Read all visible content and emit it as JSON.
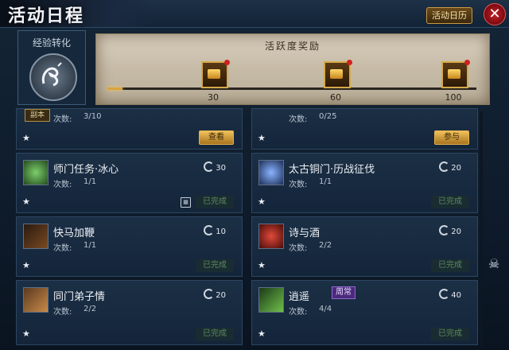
{
  "window": {
    "title": "活动日程",
    "calendar_button": "活动日历",
    "close_label": "✕"
  },
  "exp": {
    "label": "经验转化",
    "icon": "exp-convert-icon"
  },
  "reward": {
    "title": "活跃度奖励",
    "progress_fraction": 0.04,
    "chests": [
      {
        "value": "30",
        "icon": "gold-chest-icon",
        "has_notice": true
      },
      {
        "value": "60",
        "icon": "gold-chest-icon",
        "has_notice": true
      },
      {
        "value": "100",
        "icon": "gold-chest-icon",
        "has_notice": true
      }
    ]
  },
  "count_label": "次数:",
  "done_label": "已完成",
  "activities_top": [
    {
      "tag": "副本",
      "count": "3/10",
      "button": "查看"
    },
    {
      "count": "0/25",
      "button": "参与"
    }
  ],
  "activities": [
    {
      "name": "师门任务·冰心",
      "count": "1/1",
      "points": "30",
      "status": "已完成",
      "icon": "green-crystal-icon",
      "has_schedule_icon": true
    },
    {
      "name": "太古铜门·历战征伐",
      "count": "1/1",
      "points": "20",
      "status": "已完成",
      "icon": "blue-crystal-icon"
    },
    {
      "name": "快马加鞭",
      "count": "1/1",
      "points": "10",
      "status": "已完成",
      "icon": "whip-icon"
    },
    {
      "name": "诗与酒",
      "count": "2/2",
      "points": "20",
      "status": "已完成",
      "icon": "wine-jar-icon"
    },
    {
      "name": "同门弟子情",
      "count": "2/2",
      "points": "20",
      "status": "已完成",
      "icon": "disciples-icon"
    },
    {
      "name": "逍遥",
      "count": "4/4",
      "points": "40",
      "status": "已完成",
      "icon": "bamboo-icon",
      "badge": "周常"
    }
  ],
  "colors": {
    "accent_gold": "#d9a43b",
    "close_red": "#c8202a",
    "done_green": "#5b8a5d",
    "weekly_purple": "#4b2a7d"
  }
}
